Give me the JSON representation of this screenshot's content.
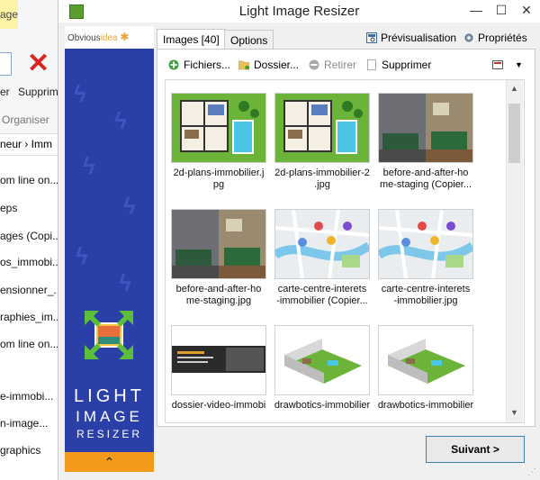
{
  "background": {
    "tab_label": "age",
    "delete_label": "Supprim",
    "left_label": "er",
    "group_label": "Organiser",
    "breadcrumb": "neur  ›  Imm",
    "items": [
      "om line on...",
      "eps",
      "ages (Copi...",
      "os_immobi...",
      "ensionner_...",
      "raphies_im...",
      "om line on...",
      "e-immobi...",
      "n-image...",
      "graphics"
    ]
  },
  "window": {
    "title": "Light Image Resizer",
    "minimize": "—",
    "maximize": "☐",
    "close": "✕"
  },
  "banner": {
    "logo_part1": "Obvious",
    "logo_part2": "idea",
    "name_line1": "LIGHT",
    "name_line2": "IMAGE",
    "name_line3": "RESIZER",
    "collapse_glyph": "⌃"
  },
  "tabs": {
    "images": "Images [40]",
    "options": "Options"
  },
  "top_links": {
    "preview": "Prévisualisation",
    "properties": "Propriétés"
  },
  "toolbar": {
    "files": "Fichiers...",
    "folder": "Dossier...",
    "remove": "Retirer",
    "delete": "Supprimer"
  },
  "images": [
    {
      "caption": "2d-plans-immobilier.j\npg",
      "kind": "plan"
    },
    {
      "caption": "2d-plans-immobilier-2\n.jpg",
      "kind": "plan"
    },
    {
      "caption": "before-and-after-ho\nme-staging (Copier...",
      "kind": "room"
    },
    {
      "caption": "before-and-after-ho\nme-staging.jpg",
      "kind": "room"
    },
    {
      "caption": "carte-centre-interets\n-immobilier (Copier...",
      "kind": "map"
    },
    {
      "caption": "carte-centre-interets\n-immobilier.jpg",
      "kind": "map"
    },
    {
      "caption": "dossier-video-immobi",
      "kind": "banner"
    },
    {
      "caption": "drawbotics-immobilier",
      "kind": "iso"
    },
    {
      "caption": "drawbotics-immobilier",
      "kind": "iso"
    }
  ],
  "buttons": {
    "next": "Suivant >"
  },
  "colors": {
    "banner_blue": "#2a40a8",
    "banner_orange": "#f39a1c",
    "accent_border": "#3c7fb1"
  }
}
